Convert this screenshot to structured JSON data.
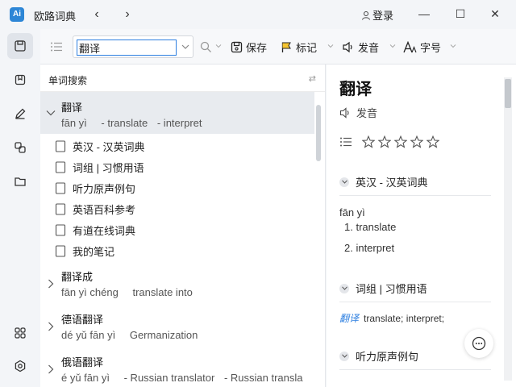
{
  "app": {
    "title": "欧路词典",
    "logo": "Ai"
  },
  "nav": {
    "back": "‹",
    "forward": "›"
  },
  "account": {
    "login_label": "登录"
  },
  "window": {
    "minimize": "—",
    "maximize": "☐",
    "close": "✕"
  },
  "search": {
    "value": "翻译",
    "placeholder": ""
  },
  "toolbar": {
    "save_label": "保存",
    "mark_label": "标记",
    "speak_label": "发音",
    "font_label": "字号"
  },
  "left_panel": {
    "header_title": "单词搜索",
    "header_swap": "⇄",
    "selected_entry": {
      "word": "翻译",
      "pinyin": "fān yì",
      "defs": [
        "- translate",
        "- interpret"
      ]
    },
    "sub_items": [
      "英汉 - 汉英词典",
      "词组 | 习惯用语",
      "听力原声例句",
      "英语百科参考",
      "有道在线词典",
      "我的笔记"
    ],
    "entries": [
      {
        "word": "翻译成",
        "pinyin": "fān yì chéng",
        "defs": [
          "translate into"
        ]
      },
      {
        "word": "德语翻译",
        "pinyin": "dé yǔ fān yì",
        "defs": [
          "Germanization"
        ]
      },
      {
        "word": "俄语翻译",
        "pinyin": "é yǔ fān yì",
        "defs": [
          "- Russian translator",
          "- Russian transla"
        ]
      }
    ]
  },
  "right_panel": {
    "word": "翻译",
    "audio_label": "发音",
    "rating": 0,
    "sections": [
      {
        "title": "英汉 - 汉英词典"
      },
      {
        "title": "词组 | 习惯用语"
      },
      {
        "title": "听力原声例句"
      }
    ],
    "pinyin": "fān yì",
    "definitions": [
      "1. translate",
      "2. interpret"
    ],
    "phrase": {
      "word": "翻译",
      "meaning": "translate; interpret;"
    }
  },
  "colors": {
    "accent": "#2d7fe0",
    "logo": "#2d86d6",
    "selected_row": "#e8ebef"
  }
}
